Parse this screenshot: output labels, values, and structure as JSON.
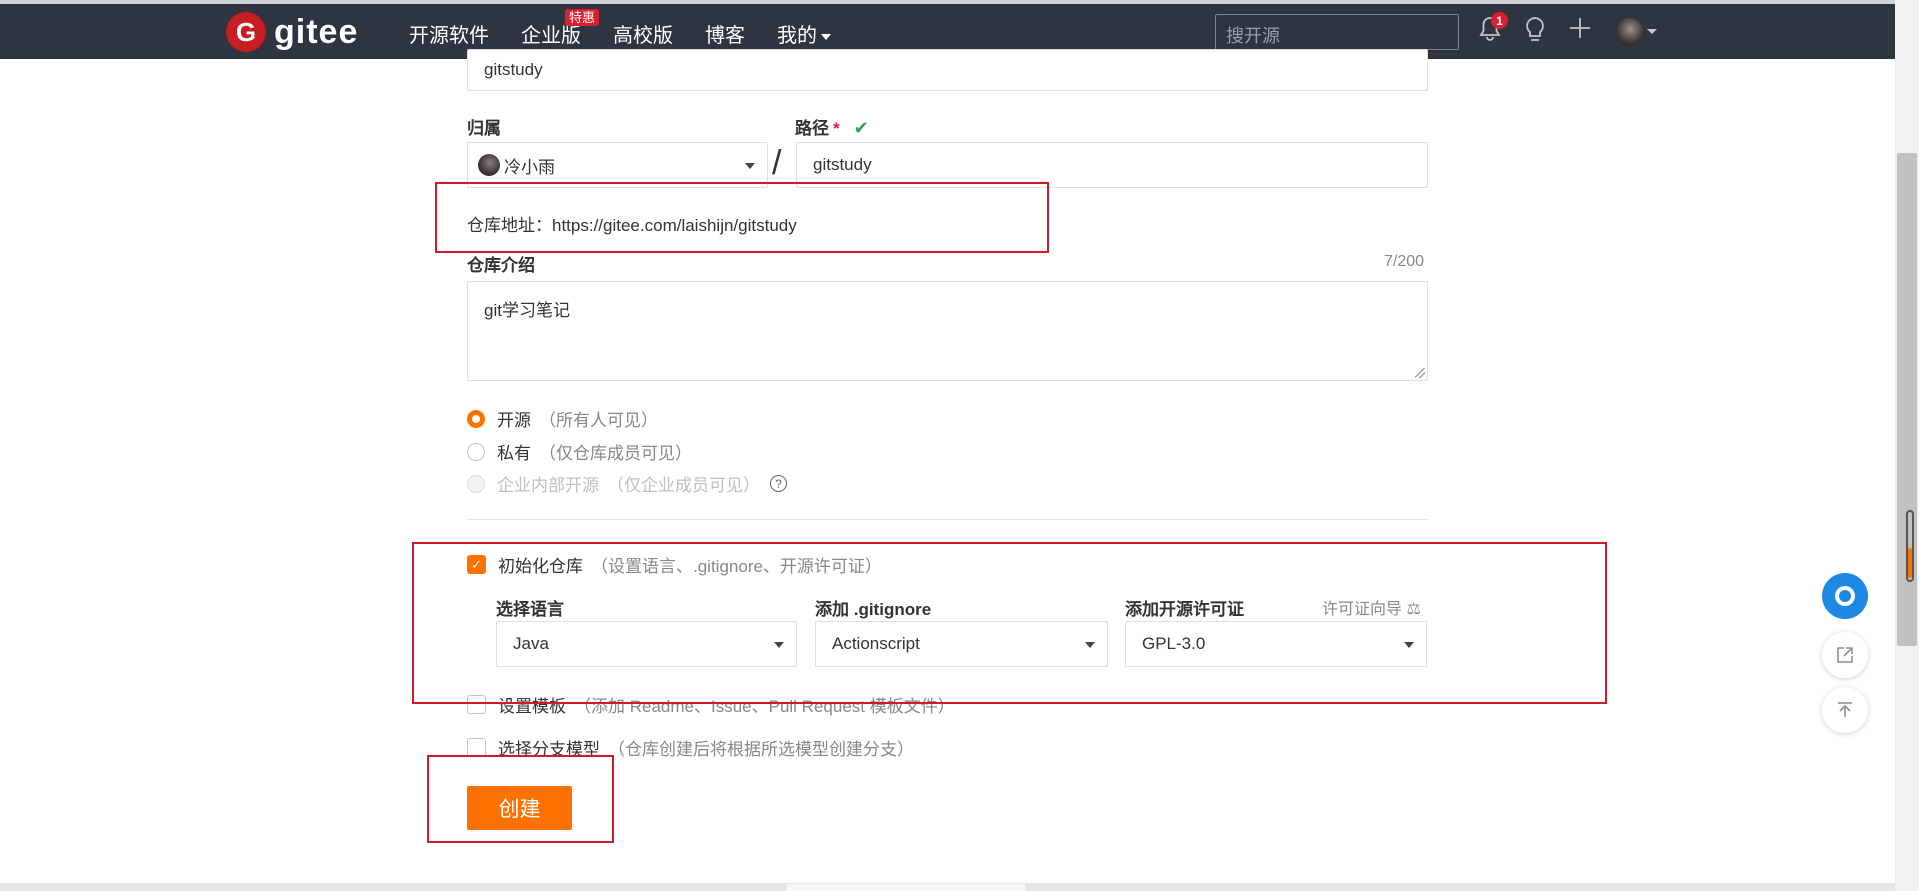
{
  "nav": {
    "logo_letter": "G",
    "logo_text": "gitee",
    "items": [
      {
        "label": "开源软件"
      },
      {
        "label": "企业版",
        "badge": "特惠"
      },
      {
        "label": "高校版"
      },
      {
        "label": "博客"
      },
      {
        "label": "我的"
      }
    ],
    "search_placeholder": "搜开源",
    "notification_count": "1",
    "icons": [
      "bell-icon",
      "lightbulb-icon",
      "plus-icon",
      "avatar"
    ]
  },
  "form": {
    "repo_name_value": "gitstudy",
    "owner_label": "归属",
    "owner_value": "冷小雨",
    "path_label": "路径",
    "path_required": "*",
    "path_ok": "✔",
    "path_value": "gitstudy",
    "repo_url": "仓库地址：https://gitee.com/laishijn/gitstudy",
    "desc_label": "仓库介绍",
    "desc_counter": "7/200",
    "desc_value": "git学习笔记",
    "visibility": [
      {
        "label": "开源",
        "hint": "（所有人可见）",
        "selected": true,
        "disabled": false
      },
      {
        "label": "私有",
        "hint": "（仅仓库成员可见）",
        "selected": false,
        "disabled": false
      },
      {
        "label": "企业内部开源",
        "hint": "（仅企业成员可见）",
        "selected": false,
        "disabled": true
      }
    ],
    "init_repo": {
      "label": "初始化仓库",
      "hint": "（设置语言、.gitignore、开源许可证）",
      "checked": true
    },
    "language_label": "选择语言",
    "language_value": "Java",
    "gitignore_label": "添加 .gitignore",
    "gitignore_value": "Actionscript",
    "license_label": "添加开源许可证",
    "license_guide": "许可证向导",
    "license_value": "GPL-3.0",
    "template": {
      "label": "设置模板",
      "hint": "（添加 Readme、Issue、Pull Request 模板文件）",
      "checked": false
    },
    "branch_model": {
      "label": "选择分支模型",
      "hint": "（仓库创建后将根据所选模型创建分支）",
      "checked": false
    },
    "create_button": "创建"
  },
  "colors": {
    "accent": "#fe7300",
    "nav_bg": "#2e3440",
    "annotation": "#d01c2a",
    "success": "#2ea44f"
  }
}
